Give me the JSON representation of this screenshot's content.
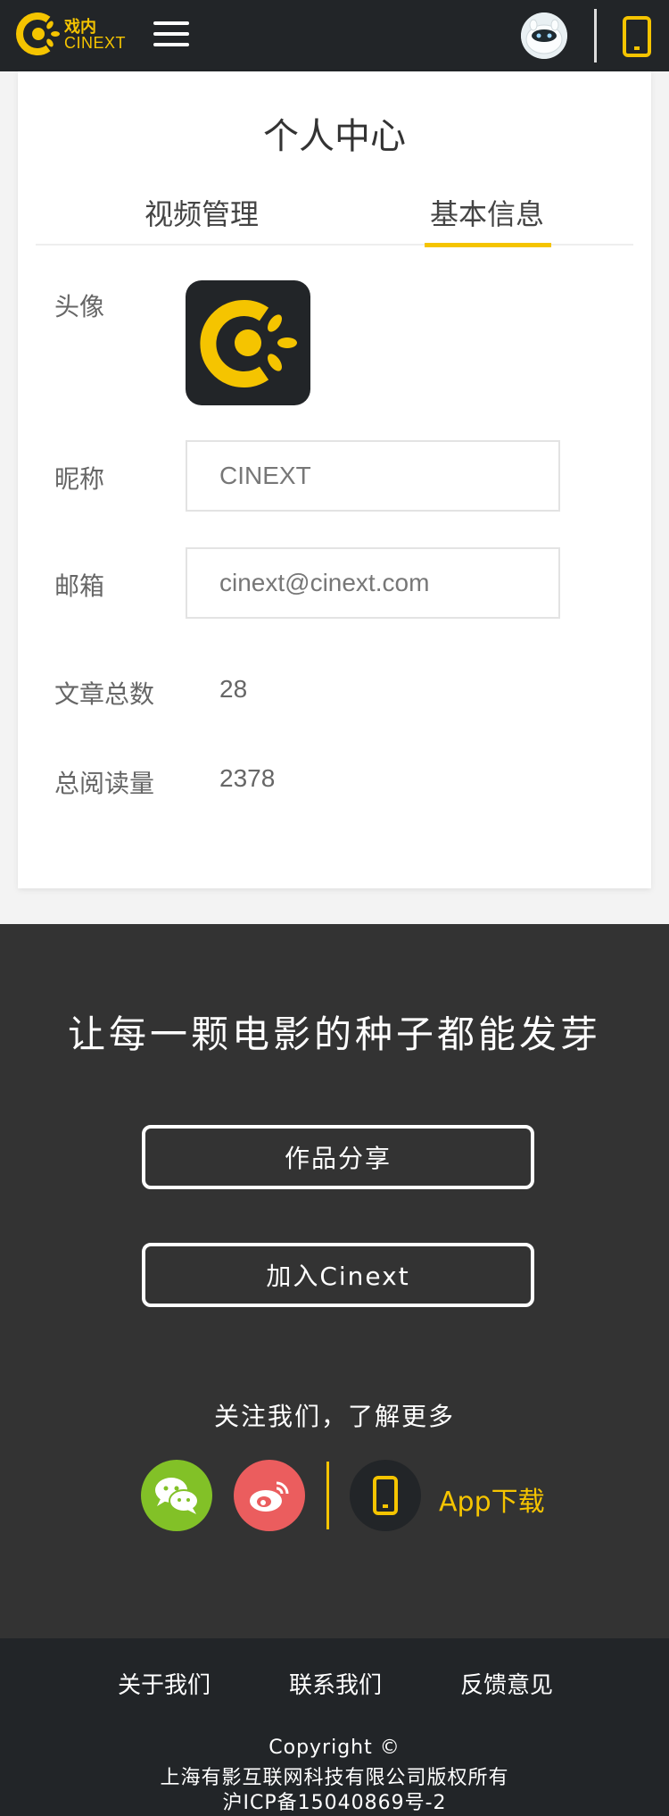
{
  "header": {
    "logo_cn": "戏内",
    "logo_en": "CINEXT",
    "icons": {
      "menu": "hamburger-menu-icon",
      "avatar": "user-avatar",
      "phone": "phone-icon"
    },
    "colors": {
      "bg": "#222528",
      "accent": "#f5c400"
    }
  },
  "card": {
    "title": "个人中心",
    "tabs": [
      {
        "label": "视频管理",
        "active": false
      },
      {
        "label": "基本信息",
        "active": true
      }
    ],
    "avatar_label": "头像",
    "nickname_label": "昵称",
    "nickname_value": "CINEXT",
    "email_label": "邮箱",
    "email_value": "cinext@cinext.com",
    "articles_label": "文章总数",
    "articles_value": "28",
    "reads_label": "总阅读量",
    "reads_value": "2378"
  },
  "promo": {
    "slogan": "让每一颗电影的种子都能发芽",
    "share_button": "作品分享",
    "join_button": "加入Cinext",
    "follow_text": "关注我们，了解更多",
    "app_label": "App下载",
    "colors": {
      "bg": "#333333",
      "wechat": "#82c127",
      "weibo": "#eb5d5e"
    }
  },
  "footer": {
    "links": [
      "关于我们",
      "联系我们",
      "反馈意见"
    ],
    "copyright": "Copyright ©",
    "company": "上海有影互联网科技有限公司版权所有",
    "icp": "沪ICP备15040869号-2"
  }
}
